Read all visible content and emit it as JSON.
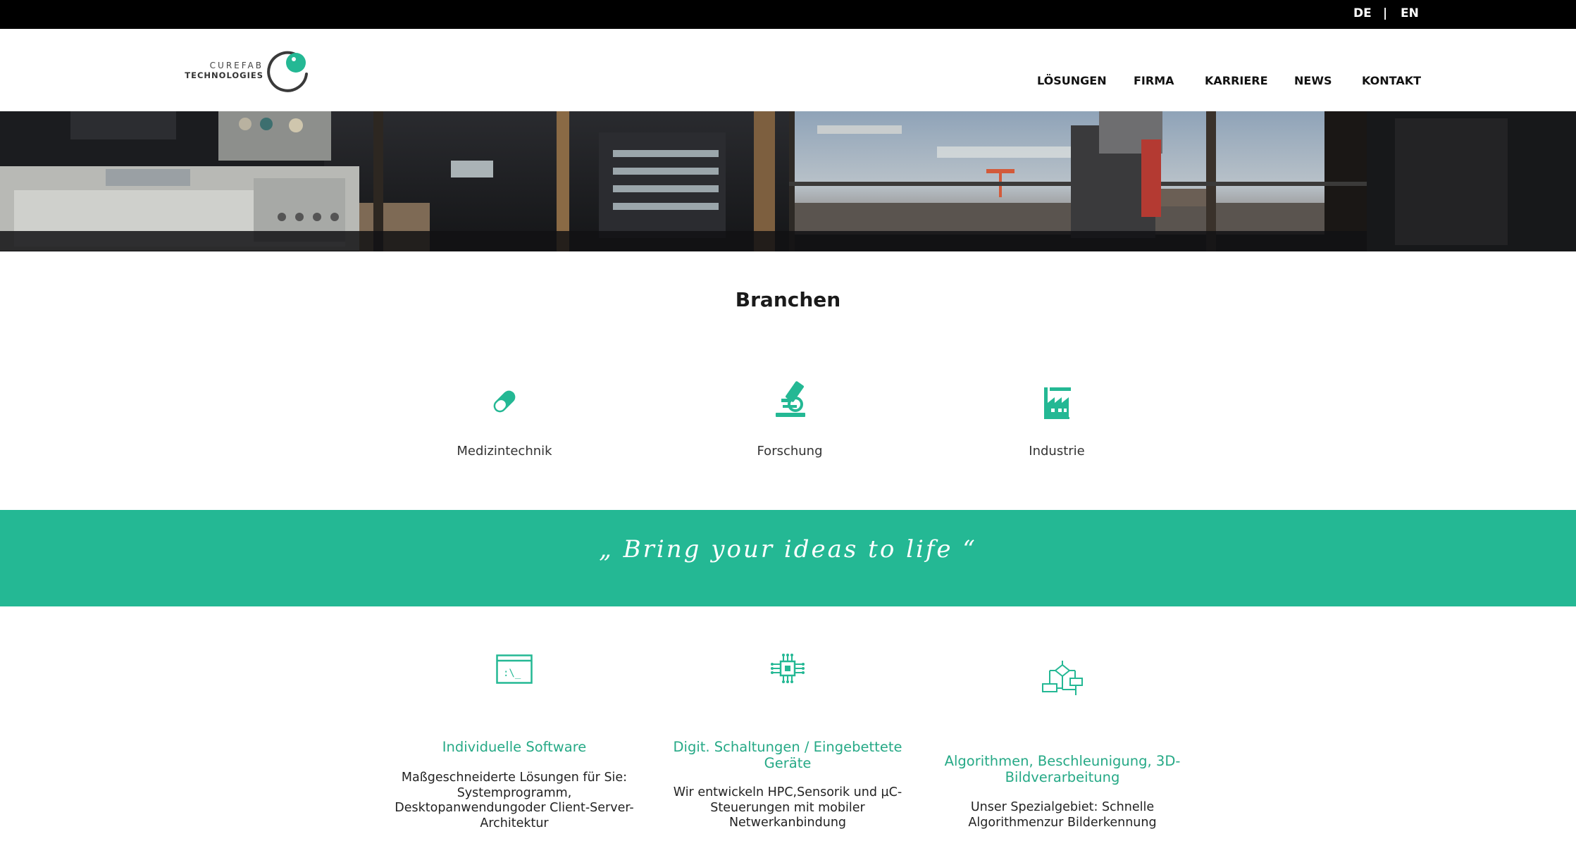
{
  "lang": {
    "de": "DE",
    "separator": "|",
    "en": "EN"
  },
  "logo": {
    "line1": "CUREFAB",
    "line2": "TECHNOLOGIES"
  },
  "nav": [
    "LÖSUNGEN",
    "FIRMA",
    "KARRIERE",
    "NEWS",
    "KONTAKT"
  ],
  "branchen": {
    "heading": "Branchen",
    "items": [
      {
        "label": "Medizintechnik",
        "icon": "pill-icon"
      },
      {
        "label": "Forschung",
        "icon": "microscope-icon"
      },
      {
        "label": "Industrie",
        "icon": "factory-icon"
      }
    ]
  },
  "quote": "„ Bring your ideas to life “",
  "services": [
    {
      "icon": "terminal-icon",
      "title": "Individuelle Software",
      "desc": [
        "Maßgeschneiderte Lösungen für Sie:",
        "Systemprogramm,",
        "Desktopanwendungoder Client-Server-",
        "Architektur"
      ]
    },
    {
      "icon": "chip-icon",
      "title_lines": [
        "Digit. Schaltungen / Eingebettete",
        "Geräte"
      ],
      "desc": [
        "Wir entwickeln HPC,Sensorik und µC-",
        "Steuerungen mit mobiler",
        "Netwerkanbindung"
      ]
    },
    {
      "icon": "flowchart-icon",
      "title_lines": [
        "Algorithmen, Beschleunigung, 3D-",
        "Bildverarbeitung"
      ],
      "desc": [
        "Unser Spezialgebiet: Schnelle",
        "Algorithmenzur Bilderkennung"
      ]
    }
  ],
  "colors": {
    "accent": "#24b894",
    "accent_text": "#26a986",
    "topbar": "#000000"
  }
}
